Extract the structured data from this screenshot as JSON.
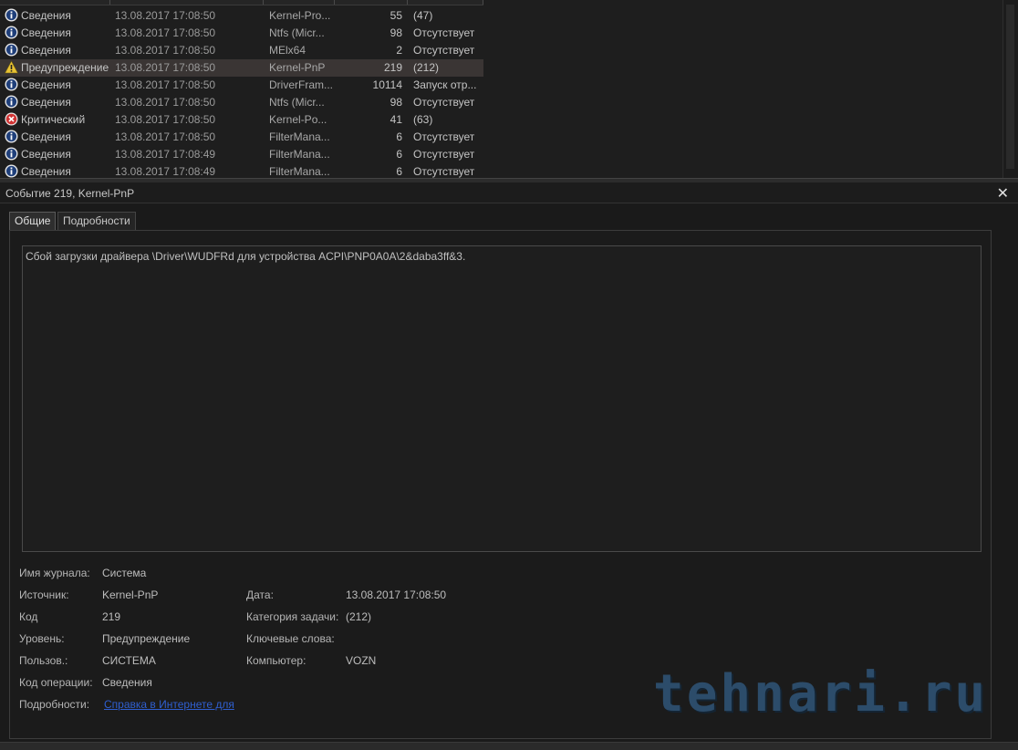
{
  "events": [
    {
      "icon": "info",
      "level": "Сведения",
      "date": "13.08.2017 17:08:50",
      "source": "Kernel-Pro...",
      "id": "55",
      "category": "(47)"
    },
    {
      "icon": "info",
      "level": "Сведения",
      "date": "13.08.2017 17:08:50",
      "source": "Ntfs (Micr...",
      "id": "98",
      "category": "Отсутствует"
    },
    {
      "icon": "info",
      "level": "Сведения",
      "date": "13.08.2017 17:08:50",
      "source": "MElx64",
      "id": "2",
      "category": "Отсутствует"
    },
    {
      "icon": "warning",
      "level": "Предупреждение",
      "date": "13.08.2017 17:08:50",
      "source": "Kernel-PnP",
      "id": "219",
      "category": "(212)",
      "selected": true
    },
    {
      "icon": "info",
      "level": "Сведения",
      "date": "13.08.2017 17:08:50",
      "source": "DriverFram...",
      "id": "10114",
      "category": "Запуск отр..."
    },
    {
      "icon": "info",
      "level": "Сведения",
      "date": "13.08.2017 17:08:50",
      "source": "Ntfs (Micr...",
      "id": "98",
      "category": "Отсутствует"
    },
    {
      "icon": "error",
      "level": "Критический",
      "date": "13.08.2017 17:08:50",
      "source": "Kernel-Po...",
      "id": "41",
      "category": "(63)"
    },
    {
      "icon": "info",
      "level": "Сведения",
      "date": "13.08.2017 17:08:50",
      "source": "FilterMana...",
      "id": "6",
      "category": "Отсутствует"
    },
    {
      "icon": "info",
      "level": "Сведения",
      "date": "13.08.2017 17:08:49",
      "source": "FilterMana...",
      "id": "6",
      "category": "Отсутствует"
    },
    {
      "icon": "info",
      "level": "Сведения",
      "date": "13.08.2017 17:08:49",
      "source": "FilterMana...",
      "id": "6",
      "category": "Отсутствует"
    }
  ],
  "detail": {
    "title": "Событие 219, Kernel-PnP",
    "tabs": [
      "Общие",
      "Подробности"
    ],
    "message": "Сбой загрузки драйвера \\Driver\\WUDFRd для устройства ACPI\\PNP0A0A\\2&daba3ff&3.",
    "fields": {
      "log_label": "Имя журнала:",
      "log_value": "Система",
      "source_label": "Источник:",
      "source_value": "Kernel-PnP",
      "date_label": "Дата:",
      "date_value": "13.08.2017 17:08:50",
      "code_label": "Код",
      "code_value": "219",
      "task_label": "Категория задачи:",
      "task_value": "(212)",
      "level_label": "Уровень:",
      "level_value": "Предупреждение",
      "keywords_label": "Ключевые слова:",
      "keywords_value": "",
      "user_label": "Пользов.:",
      "user_value": "СИСТЕМА",
      "computer_label": "Компьютер:",
      "computer_value": "VOZN",
      "opcode_label": "Код операции:",
      "opcode_value": "Сведения",
      "more_label": "Подробности:",
      "more_link": "Справка в Интернете для"
    }
  },
  "watermark": "tehnari.ru",
  "colors": {
    "selected_row": "#3a3534",
    "link": "#2f5fd0",
    "info_icon": "#e8e8e8",
    "warning_icon": "#e8c233",
    "error_icon": "#d03434"
  }
}
